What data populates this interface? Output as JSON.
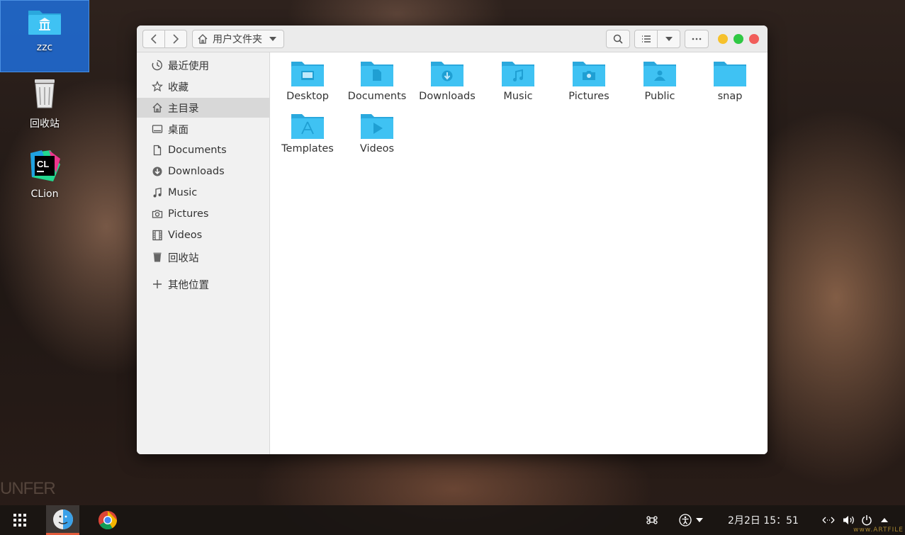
{
  "desktop": {
    "icons": [
      {
        "label": "zzc",
        "icon": "folder-home-icon"
      },
      {
        "label": "回收站",
        "icon": "trash-icon"
      },
      {
        "label": "CLion",
        "icon": "clion-icon"
      }
    ],
    "watermark": "UNFER"
  },
  "window": {
    "path_label": "用户文件夹",
    "sidebar": [
      {
        "label": "最近使用",
        "icon": "recent-icon"
      },
      {
        "label": "收藏",
        "icon": "star-icon"
      },
      {
        "label": "主目录",
        "icon": "home-icon",
        "active": true
      },
      {
        "label": "桌面",
        "icon": "desktop-icon"
      },
      {
        "label": "Documents",
        "icon": "document-icon"
      },
      {
        "label": "Downloads",
        "icon": "download-icon"
      },
      {
        "label": "Music",
        "icon": "music-icon"
      },
      {
        "label": "Pictures",
        "icon": "camera-icon"
      },
      {
        "label": "Videos",
        "icon": "film-icon"
      },
      {
        "label": "回收站",
        "icon": "trash-icon"
      },
      {
        "label": "其他位置",
        "icon": "plus-icon"
      }
    ],
    "files": [
      {
        "label": "Desktop",
        "icon": "folder-desktop-icon"
      },
      {
        "label": "Documents",
        "icon": "folder-documents-icon"
      },
      {
        "label": "Downloads",
        "icon": "folder-downloads-icon"
      },
      {
        "label": "Music",
        "icon": "folder-music-icon"
      },
      {
        "label": "Pictures",
        "icon": "folder-pictures-icon"
      },
      {
        "label": "Public",
        "icon": "folder-public-icon"
      },
      {
        "label": "snap",
        "icon": "folder-icon"
      },
      {
        "label": "Templates",
        "icon": "folder-templates-icon"
      },
      {
        "label": "Videos",
        "icon": "folder-videos-icon"
      }
    ]
  },
  "taskbar": {
    "clock": "2月2日 15：51",
    "watermark": "www.ARTFILE"
  },
  "colors": {
    "folder": "#3fc2f3",
    "folder_tab": "#2aa8dd",
    "close": "#f15d5a",
    "minimize": "#f6c12b",
    "maximize": "#2fc843",
    "selection": "#1e6edc"
  }
}
